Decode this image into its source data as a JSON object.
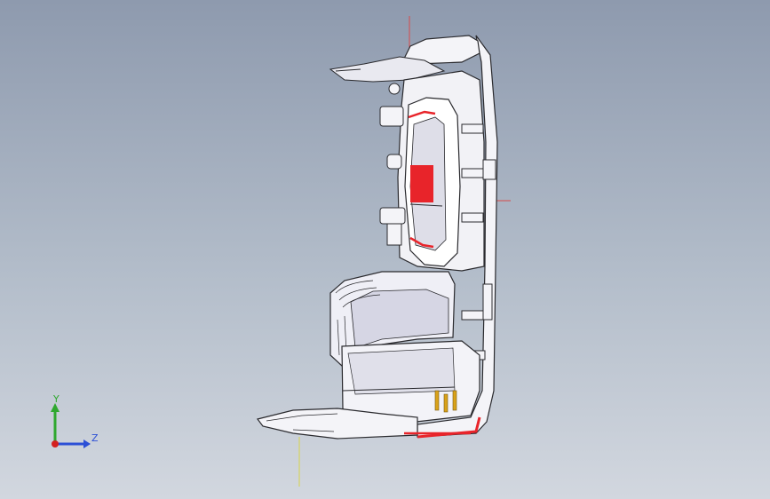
{
  "viewport": {
    "background_top": "#8e9aae",
    "background_bottom": "#d2d7df"
  },
  "model": {
    "section_color": "#e8242a",
    "body_color": "#f4f4f8",
    "outline_color": "#2a2a2e",
    "shade_color": "#c9c9d6",
    "terminal_color": "#d9a21a"
  },
  "triad": {
    "y_label": "Y",
    "z_label": "Z",
    "y_color": "#2fa82f",
    "z_color": "#2b4fd6",
    "x_color": "#d42020"
  },
  "reference_axes": {
    "vertical_color": "#d8d44a",
    "horizontal_color": "#d84a4a"
  }
}
